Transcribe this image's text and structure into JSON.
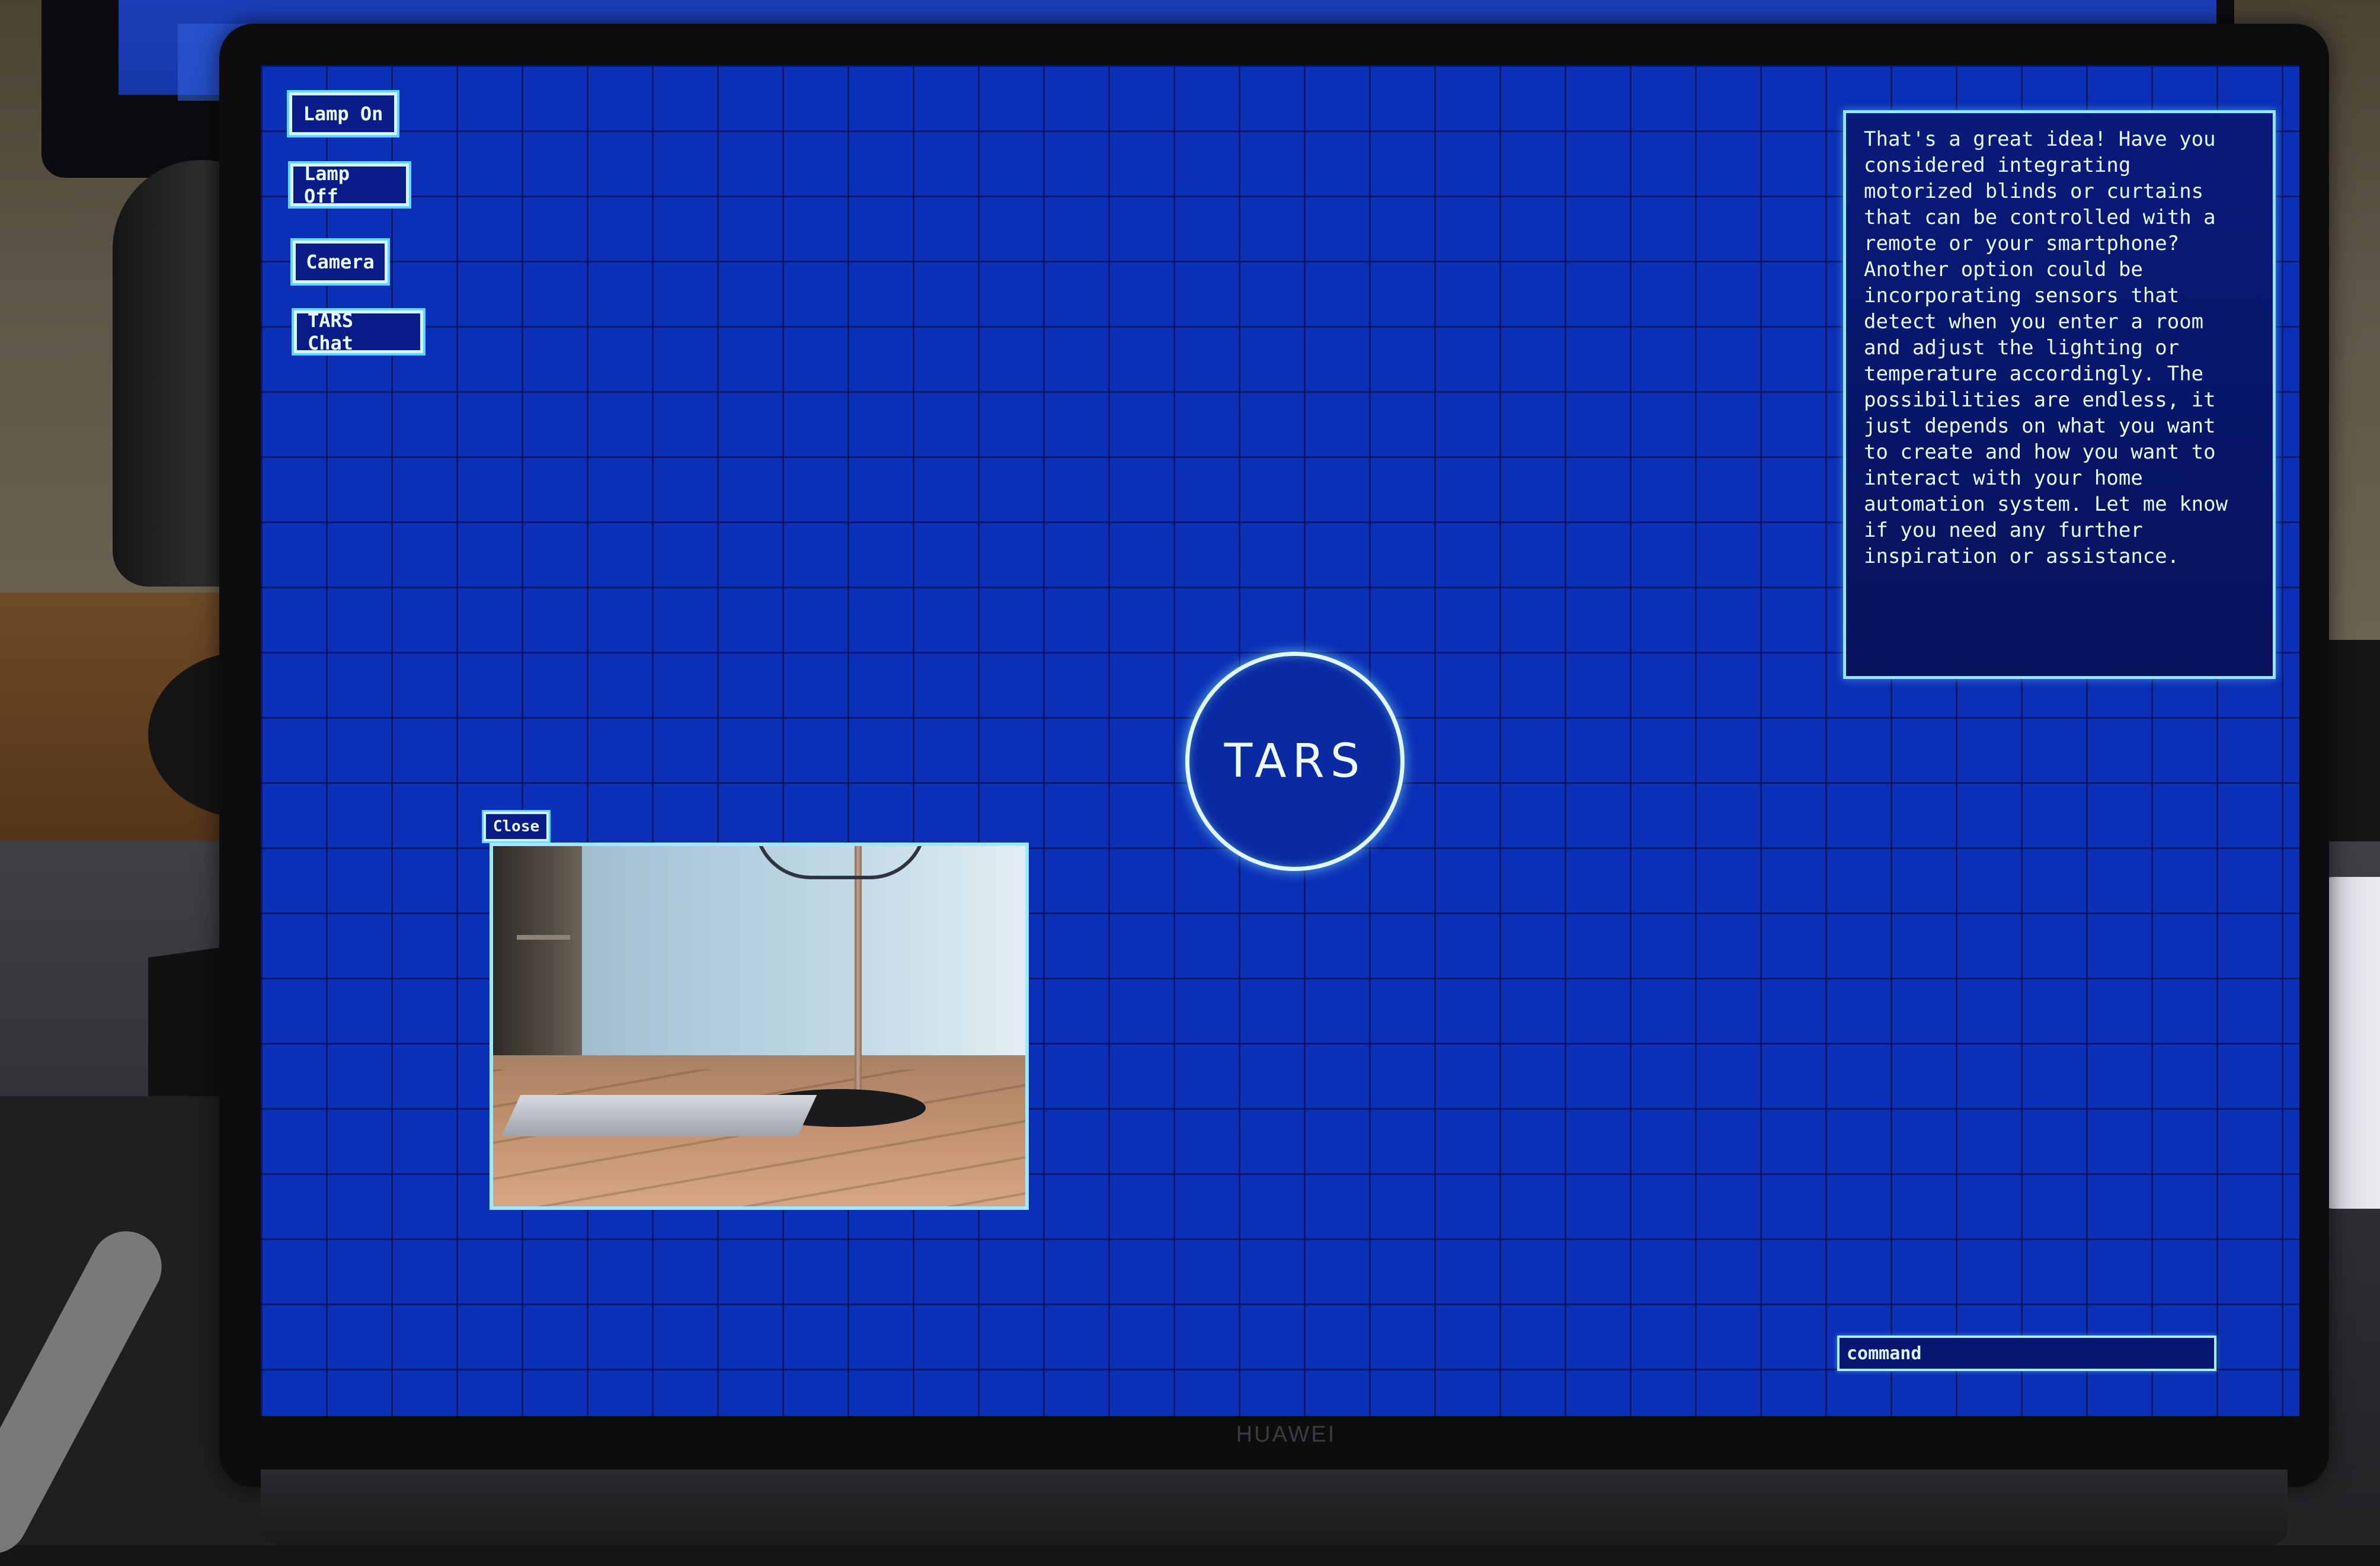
{
  "device": {
    "brand": "HUAWEI"
  },
  "app": {
    "logo_text": "TARS"
  },
  "sidebar": {
    "buttons": [
      {
        "id": "lamp_on",
        "label": "Lamp On"
      },
      {
        "id": "lamp_off",
        "label": "Lamp Off"
      },
      {
        "id": "camera",
        "label": "Camera"
      },
      {
        "id": "tars_chat",
        "label": "TARS Chat"
      }
    ]
  },
  "chat": {
    "response": "That's a great idea! Have you\nconsidered integrating\nmotorized blinds or curtains\nthat can be controlled with a\nremote or your smartphone?\nAnother option could be\nincorporating sensors that\ndetect when you enter a room\nand adjust the lighting or\ntemperature accordingly. The\npossibilities are endless, it\njust depends on what you want\nto create and how you want to\ninteract with your home\nautomation system. Let me know\nif you need any further\ninspiration or assistance."
  },
  "camera_window": {
    "close_label": "Close"
  },
  "command": {
    "placeholder": "command"
  },
  "colors": {
    "screen_background": "#0b2fb6",
    "accent": "#5fd6ff",
    "text": "#e8fbff"
  }
}
